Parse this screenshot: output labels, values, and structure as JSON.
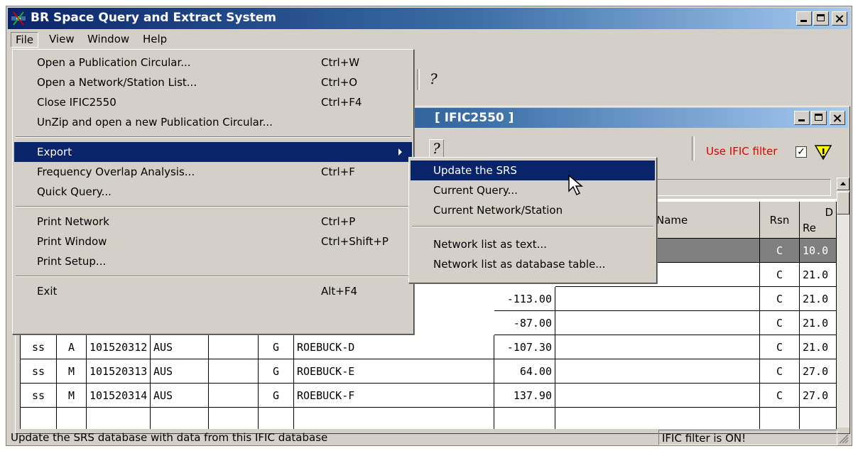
{
  "app": {
    "title": "BR Space Query and Extract System"
  },
  "menubar": [
    "File",
    "View",
    "Window",
    "Help"
  ],
  "toolbar": {
    "help_glyph": "?"
  },
  "doc_window": {
    "title": "[ IFIC2550 ]",
    "filter_label": "Use IFIC filter",
    "filter_checked": "✓",
    "help_glyph": "?"
  },
  "file_menu": [
    {
      "label": "Open a Publication Circular...",
      "shortcut": "Ctrl+W"
    },
    {
      "label": "Open a Network/Station List...",
      "shortcut": "Ctrl+O"
    },
    {
      "label": "Close IFIC2550",
      "shortcut": "Ctrl+F4"
    },
    {
      "label": "UnZip and open a new Publication Circular...",
      "shortcut": ""
    },
    {
      "label": "Export",
      "shortcut": ""
    },
    {
      "label": "Frequency Overlap Analysis...",
      "shortcut": "Ctrl+F"
    },
    {
      "label": "Quick Query...",
      "shortcut": ""
    },
    {
      "label": "Print Network",
      "shortcut": "Ctrl+P"
    },
    {
      "label": "Print Window",
      "shortcut": "Ctrl+Shift+P"
    },
    {
      "label": "Print Setup...",
      "shortcut": ""
    },
    {
      "label": "Exit",
      "shortcut": "Alt+F4"
    }
  ],
  "export_submenu": [
    "Update the SRS",
    "Current Query...",
    "Current Network/Station",
    "Network list as text...",
    "Network list as database table..."
  ],
  "table": {
    "headers": {
      "name": "Name",
      "rsn": "Rsn",
      "rec_top": "D",
      "rec_bottom": "Re"
    },
    "partial_rows": [
      {
        "val": "",
        "rsn": "C",
        "rec": "10.0"
      },
      {
        "val": "",
        "rsn": "C",
        "rec": "21.0"
      },
      {
        "val": "-113.00",
        "rsn": "C",
        "rec": "21.0"
      },
      {
        "val": "-87.00",
        "rsn": "C",
        "rec": "21.0"
      }
    ],
    "rows": [
      {
        "type": "ss",
        "act": "A",
        "id": "101520312",
        "adm": "AUS",
        "cls": "G",
        "name": "ROEBUCK-D",
        "val": "-107.30",
        "rsn": "C",
        "rec": "21.0"
      },
      {
        "type": "ss",
        "act": "M",
        "id": "101520313",
        "adm": "AUS",
        "cls": "G",
        "name": "ROEBUCK-E",
        "val": "64.00",
        "rsn": "C",
        "rec": "27.0"
      },
      {
        "type": "ss",
        "act": "M",
        "id": "101520314",
        "adm": "AUS",
        "cls": "G",
        "name": "ROEBUCK-F",
        "val": "137.90",
        "rsn": "C",
        "rec": "27.0"
      }
    ]
  },
  "status": {
    "message": "Update the SRS database with data from this IFIC database",
    "filter_state": "IFIC filter is ON!"
  }
}
